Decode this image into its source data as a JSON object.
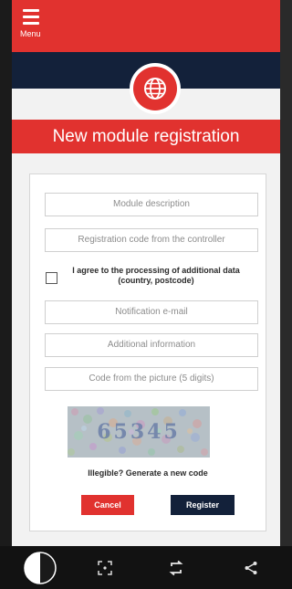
{
  "header": {
    "menu_label": "Menu"
  },
  "page": {
    "title": "New module registration"
  },
  "form": {
    "module_description_placeholder": "Module description",
    "registration_code_placeholder": "Registration code from the controller",
    "consent_label": "I agree to the processing of additional data (country, postcode)",
    "consent_checked": false,
    "notification_email_placeholder": "Notification e-mail",
    "additional_info_placeholder": "Additional information",
    "captcha_code_placeholder": "Code from the picture (5 digits)",
    "captcha_image_text": "65345",
    "illegible_link": "Illegible? Generate a new code",
    "cancel_label": "Cancel",
    "register_label": "Register"
  },
  "colors": {
    "accent_red": "#e1322f",
    "navy": "#13213a",
    "background": "#f2f2f2"
  },
  "icons": {
    "menu": "hamburger-icon",
    "globe": "globe-icon",
    "bottom_nav": [
      "contrast-icon",
      "focus-icon",
      "rotate-icon",
      "share-icon"
    ]
  }
}
